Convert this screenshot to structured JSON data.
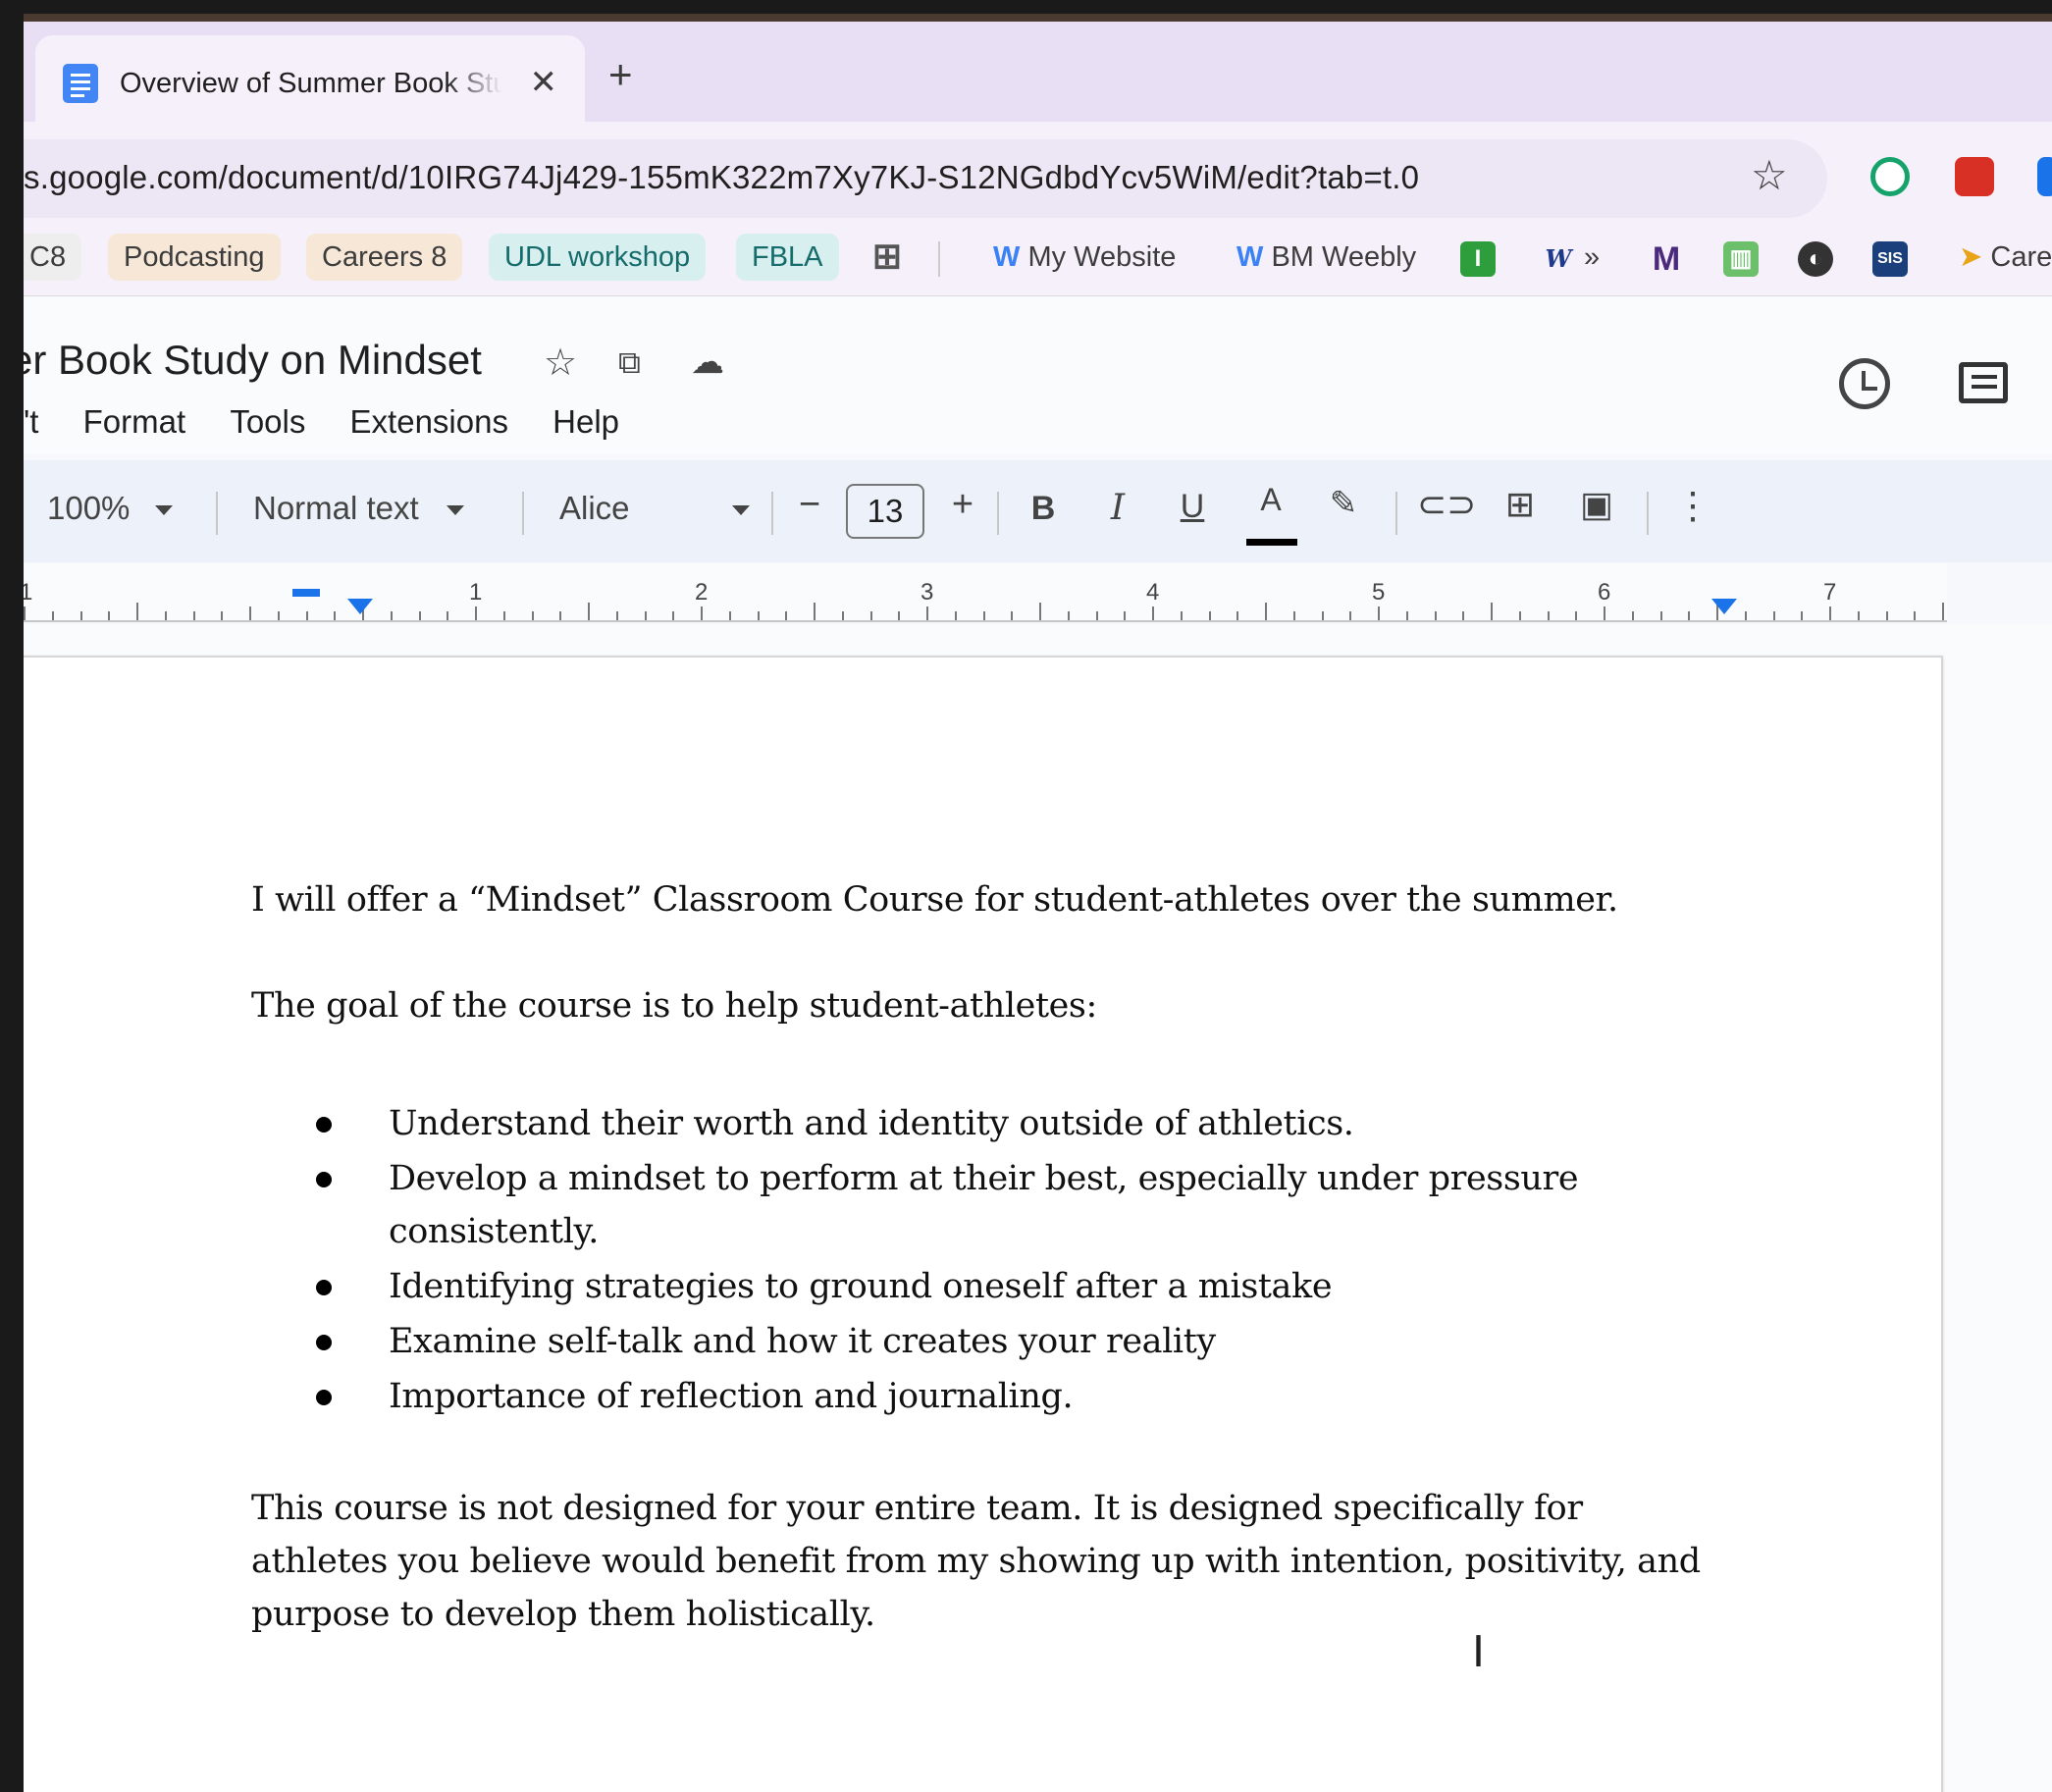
{
  "browser": {
    "tab_title": "Overview of Summer Book Study on Mindset",
    "tab_close": "✕",
    "new_tab": "+",
    "url": "s.google.com/document/d/10IRG74Jj429-155mK322m7Xy7KJ-S12NGdbdYcv5WiM/edit?tab=t.0"
  },
  "bookmarks": [
    {
      "label": "C8",
      "color": "#eeeeee"
    },
    {
      "label": "Podcasting",
      "color": "#f6e7d7"
    },
    {
      "label": "Careers 8",
      "color": "#f6e7d7"
    },
    {
      "label": "UDL workshop",
      "color": "#d7efef"
    },
    {
      "label": "FBLA",
      "color": "#d7efef"
    },
    {
      "label": "My Website",
      "color": "transparent"
    },
    {
      "label": "BM Weebly",
      "color": "transparent"
    },
    {
      "label": "»",
      "color": "transparent"
    },
    {
      "label": "Care",
      "color": "transparent"
    }
  ],
  "bookmark_icons": {
    "apps": "apps-grid-icon",
    "weebly1": "weebly-icon",
    "weebly2": "weebly-icon",
    "green_i": "i-icon",
    "wikipedia": "W",
    "m": "M",
    "sis": "SIS"
  },
  "doc": {
    "title": "er Book Study on Mindset",
    "menu": [
      "'t",
      "Format",
      "Tools",
      "Extensions",
      "Help"
    ]
  },
  "format_toolbar": {
    "zoom": "100%",
    "style": "Normal text",
    "font": "Alice",
    "font_size": "13",
    "decrease": "−",
    "increase": "+",
    "bold": "B",
    "italic": "I",
    "underline": "U",
    "text_color": "A",
    "more": "⋮"
  },
  "ruler": {
    "labels": [
      "1",
      "1",
      "2",
      "3",
      "4",
      "5",
      "6",
      "7"
    ]
  },
  "content": {
    "p1": "I will offer a “Mindset” Classroom Course for student-athletes over the summer.",
    "p2": "The goal of the course is to help student-athletes:",
    "bullets": [
      "Understand their worth and identity outside of athletics.",
      "Develop a mindset to perform at their best, especially under pressure consistently.",
      "Identifying strategies to ground oneself after a mistake",
      "Examine self-talk and how it creates your reality",
      "Importance of reflection and journaling."
    ],
    "p3": "This course is not designed for your entire team. It is designed specifically for athletes you believe would benefit from my showing up with intention, positivity, and purpose to develop them holistically."
  },
  "colors": {
    "accent": "#1a73e8",
    "tab_strip": "#e8dff5",
    "docs_blue": "#4285f4"
  }
}
